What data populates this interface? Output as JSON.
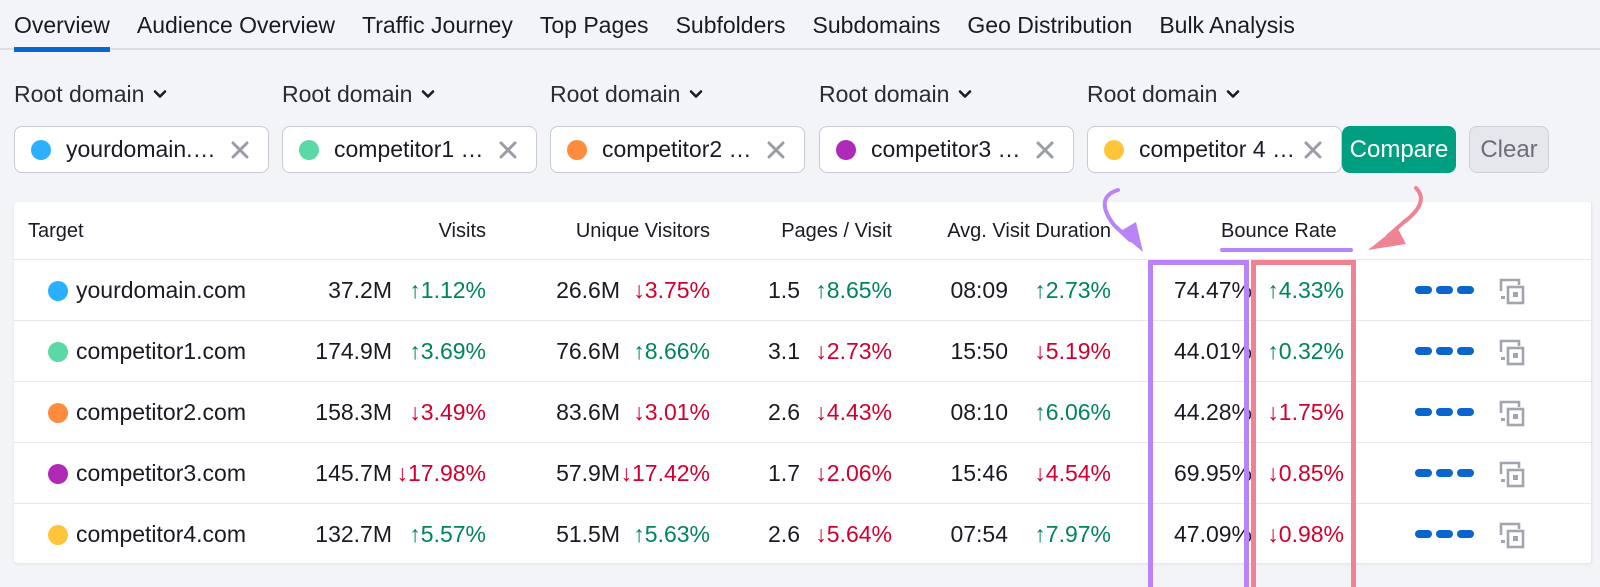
{
  "tabs": [
    {
      "label": "Overview",
      "active": true
    },
    {
      "label": "Audience Overview",
      "active": false
    },
    {
      "label": "Traffic Journey",
      "active": false
    },
    {
      "label": "Top Pages",
      "active": false
    },
    {
      "label": "Subfolders",
      "active": false
    },
    {
      "label": "Subdomains",
      "active": false
    },
    {
      "label": "Geo Distribution",
      "active": false
    },
    {
      "label": "Bulk Analysis",
      "active": false
    }
  ],
  "filters": [
    {
      "scope": "Root domain",
      "value": "yourdomain.…",
      "color": "#2bb0ff"
    },
    {
      "scope": "Root domain",
      "value": "competitor1 …",
      "color": "#5ad8a6"
    },
    {
      "scope": "Root domain",
      "value": "competitor2 …",
      "color": "#ff8c3c"
    },
    {
      "scope": "Root domain",
      "value": "competitor3 …",
      "color": "#b02ab8"
    },
    {
      "scope": "Root domain",
      "value": "competitor 4 …",
      "color": "#ffc53a"
    }
  ],
  "buttons": {
    "compare": "Compare",
    "clear": "Clear"
  },
  "table": {
    "headers": {
      "target": "Target",
      "visits": "Visits",
      "unique_visitors": "Unique Visitors",
      "pages_visit": "Pages / Visit",
      "avg_duration": "Avg. Visit Duration",
      "bounce_rate": "Bounce Rate"
    },
    "rows": [
      {
        "domain": "yourdomain.com",
        "color": "#2bb0ff",
        "visits": "37.2M",
        "visits_chg": "↑1.12%",
        "visits_dir": "up",
        "uv": "26.6M",
        "uv_chg": "↓3.75%",
        "uv_dir": "down",
        "pv": "1.5",
        "pv_chg": "↑8.65%",
        "pv_dir": "up",
        "dur": "08:09",
        "dur_chg": "↑2.73%",
        "dur_dir": "up",
        "br": "74.47%",
        "br_chg": "↑4.33%",
        "br_dir": "up"
      },
      {
        "domain": "competitor1.com",
        "color": "#5ad8a6",
        "visits": "174.9M",
        "visits_chg": "↑3.69%",
        "visits_dir": "up",
        "uv": "76.6M",
        "uv_chg": "↑8.66%",
        "uv_dir": "up",
        "pv": "3.1",
        "pv_chg": "↓2.73%",
        "pv_dir": "down",
        "dur": "15:50",
        "dur_chg": "↓5.19%",
        "dur_dir": "down",
        "br": "44.01%",
        "br_chg": "↑0.32%",
        "br_dir": "up"
      },
      {
        "domain": "competitor2.com",
        "color": "#ff8c3c",
        "visits": "158.3M",
        "visits_chg": "↓3.49%",
        "visits_dir": "down",
        "uv": "83.6M",
        "uv_chg": "↓3.01%",
        "uv_dir": "down",
        "pv": "2.6",
        "pv_chg": "↓4.43%",
        "pv_dir": "down",
        "dur": "08:10",
        "dur_chg": "↑6.06%",
        "dur_dir": "up",
        "br": "44.28%",
        "br_chg": "↓1.75%",
        "br_dir": "down"
      },
      {
        "domain": "competitor3.com",
        "color": "#b02ab8",
        "visits": "145.7M",
        "visits_chg": "↓17.98%",
        "visits_dir": "down",
        "uv": "57.9M",
        "uv_chg": "↓17.42%",
        "uv_dir": "down",
        "pv": "1.7",
        "pv_chg": "↓2.06%",
        "pv_dir": "down",
        "dur": "15:46",
        "dur_chg": "↓4.54%",
        "dur_dir": "down",
        "br": "69.95%",
        "br_chg": "↓0.85%",
        "br_dir": "down"
      },
      {
        "domain": "competitor4.com",
        "color": "#ffc53a",
        "visits": "132.7M",
        "visits_chg": "↑5.57%",
        "visits_dir": "up",
        "uv": "51.5M",
        "uv_chg": "↑5.63%",
        "uv_dir": "up",
        "pv": "2.6",
        "pv_chg": "↓5.64%",
        "pv_dir": "down",
        "dur": "07:54",
        "dur_chg": "↑7.97%",
        "dur_dir": "up",
        "br": "47.09%",
        "br_chg": "↓0.98%",
        "br_dir": "down"
      }
    ]
  },
  "colors": {
    "accent_blue": "#0a66cc",
    "compare_green": "#009f81",
    "up_green": "#00845f",
    "down_red": "#d1002f",
    "annotation_purple": "#b884f7",
    "annotation_pink": "#ef8394"
  }
}
